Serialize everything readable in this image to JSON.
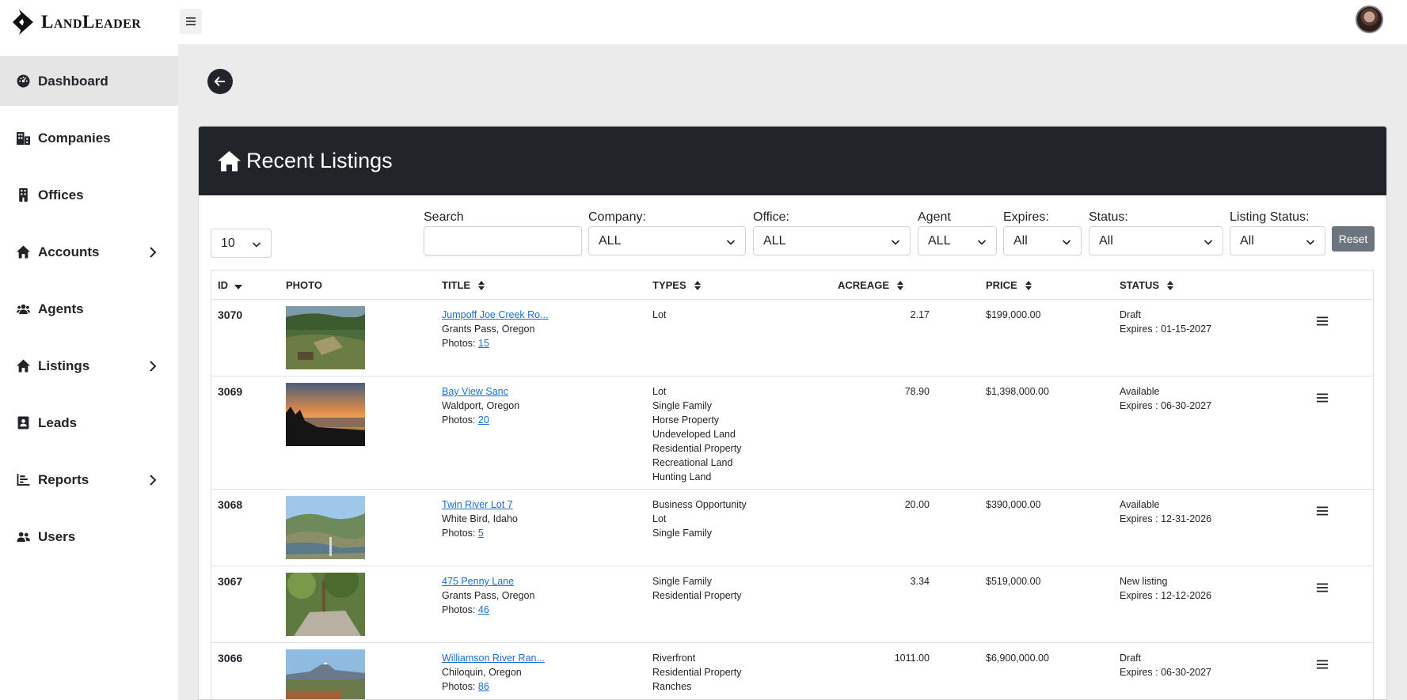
{
  "app": {
    "logo_text": "LandLeader"
  },
  "sidebar": {
    "items": [
      {
        "label": "Dashboard",
        "icon": "gauge-icon"
      },
      {
        "label": "Companies",
        "icon": "buildings-icon"
      },
      {
        "label": "Offices",
        "icon": "office-building-icon"
      },
      {
        "label": "Accounts",
        "icon": "home-icon",
        "has_submenu": true
      },
      {
        "label": "Agents",
        "icon": "people-icon"
      },
      {
        "label": "Listings",
        "icon": "home-icon",
        "has_submenu": true
      },
      {
        "label": "Leads",
        "icon": "contact-card-icon"
      },
      {
        "label": "Reports",
        "icon": "bar-chart-icon",
        "has_submenu": true
      },
      {
        "label": "Users",
        "icon": "users-icon"
      }
    ]
  },
  "card": {
    "title": "Recent Listings"
  },
  "filters": {
    "page_size": "10",
    "search_label": "Search",
    "search_value": "",
    "company_label": "Company:",
    "company_value": "ALL",
    "office_label": "Office:",
    "office_value": "ALL",
    "agent_label": "Agent",
    "agent_value": "ALL",
    "expires_label": "Expires:",
    "expires_value": "All",
    "status_label": "Status:",
    "status_value": "All",
    "listing_status_label": "Listing Status:",
    "listing_status_value": "All",
    "reset_label": "Reset"
  },
  "table": {
    "headers": {
      "id": "ID",
      "photo": "PHOTO",
      "title": "TITLE",
      "types": "TYPES",
      "acreage": "ACREAGE",
      "price": "PRICE",
      "status": "STATUS"
    },
    "rows": [
      {
        "id": "3070",
        "title": "Jumpoff Joe Creek Ro...",
        "location": "Grants Pass, Oregon",
        "photos_label": "Photos:",
        "photos_count": "15",
        "types": [
          "Lot"
        ],
        "acreage": "2.17",
        "price": "$199,000.00",
        "status": "Draft",
        "expires": "Expires : 01-15-2027"
      },
      {
        "id": "3069",
        "title": "Bay View Sanc",
        "location": "Waldport, Oregon",
        "photos_label": "Photos:",
        "photos_count": "20",
        "types": [
          "Lot",
          "Single Family",
          "Horse Property",
          "Undeveloped Land",
          "Residential Property",
          "Recreational Land",
          "Hunting Land"
        ],
        "acreage": "78.90",
        "price": "$1,398,000.00",
        "status": "Available",
        "expires": "Expires : 06-30-2027"
      },
      {
        "id": "3068",
        "title": "Twin River Lot 7",
        "location": "White Bird, Idaho",
        "photos_label": "Photos:",
        "photos_count": "5",
        "types": [
          "Business Opportunity",
          "Lot",
          "Single Family"
        ],
        "acreage": "20.00",
        "price": "$390,000.00",
        "status": "Available",
        "expires": "Expires : 12-31-2026"
      },
      {
        "id": "3067",
        "title": "475 Penny Lane",
        "location": "Grants Pass, Oregon",
        "photos_label": "Photos:",
        "photos_count": "46",
        "types": [
          "Single Family",
          "Residential Property"
        ],
        "acreage": "3.34",
        "price": "$519,000.00",
        "status": "New listing",
        "expires": "Expires : 12-12-2026"
      },
      {
        "id": "3066",
        "title": "Williamson River Ran...",
        "location": "Chiloquin, Oregon",
        "photos_label": "Photos:",
        "photos_count": "86",
        "types": [
          "Riverfront",
          "Residential Property",
          "Ranches"
        ],
        "acreage": "1011.00",
        "price": "$6,900,000.00",
        "status": "Draft",
        "expires": "Expires : 06-30-2027"
      }
    ]
  },
  "colors": {
    "header_dark": "#212529",
    "link": "#1a6fd1",
    "reset_button": "#6c757d"
  }
}
